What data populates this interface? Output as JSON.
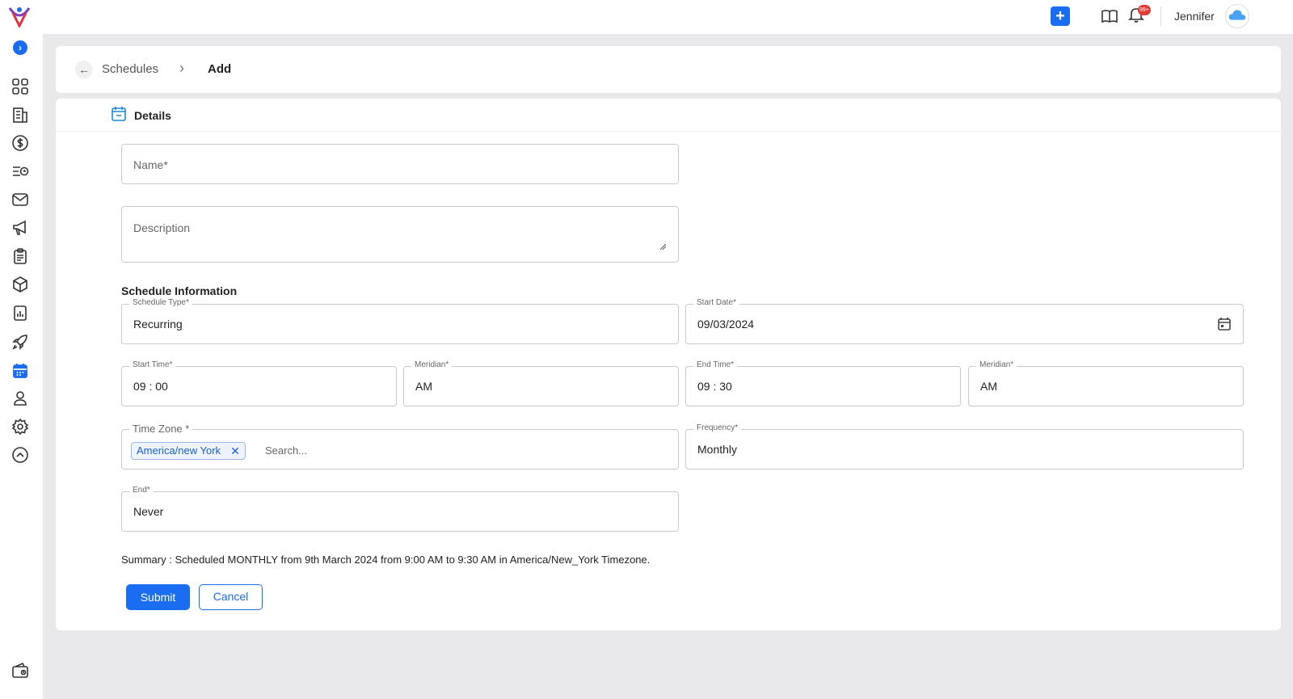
{
  "topbar": {
    "add_label": "+",
    "notification_badge": "99+",
    "username": "Jennifer"
  },
  "sidebar": {
    "toggle": "›",
    "items": [
      {
        "name": "dashboard-icon"
      },
      {
        "name": "building-icon"
      },
      {
        "name": "dollar-icon"
      },
      {
        "name": "list-clock-icon"
      },
      {
        "name": "mail-icon"
      },
      {
        "name": "megaphone-icon"
      },
      {
        "name": "clipboard-icon"
      },
      {
        "name": "cube-icon"
      },
      {
        "name": "report-icon"
      },
      {
        "name": "rocket-icon"
      },
      {
        "name": "calendar-icon",
        "active": true
      },
      {
        "name": "user-icon"
      },
      {
        "name": "settings-icon"
      },
      {
        "name": "chevron-up-icon"
      },
      {
        "name": "wallet-icon"
      }
    ]
  },
  "breadcrumb": {
    "back": "←",
    "parent": "Schedules",
    "separator": "›",
    "current": "Add"
  },
  "details": {
    "title": "Details"
  },
  "form": {
    "name_placeholder": "Name*",
    "description_placeholder": "Description",
    "section_title": "Schedule Information",
    "schedule_type": {
      "label": "Schedule Type*",
      "value": "Recurring"
    },
    "start_date": {
      "label": "Start Date*",
      "value": "09/03/2024"
    },
    "start_time": {
      "label": "Start Time*",
      "value": "09 : 00"
    },
    "start_meridian": {
      "label": "Meridian*",
      "value": "AM"
    },
    "end_time": {
      "label": "End Time*",
      "value": "09 : 30"
    },
    "end_meridian": {
      "label": "Meridian*",
      "value": "AM"
    },
    "time_zone": {
      "label": "Time Zone *",
      "chip": "America/new York",
      "chip_remove": "✕",
      "search_placeholder": "Search..."
    },
    "frequency": {
      "label": "Frequency*",
      "value": "Monthly"
    },
    "end": {
      "label": "End*",
      "value": "Never"
    },
    "summary": "Summary : Scheduled MONTHLY from 9th March 2024 from 9:00 AM to 9:30 AM in America/New_York Timezone.",
    "submit_label": "Submit",
    "cancel_label": "Cancel"
  },
  "colors": {
    "primary": "#1a6cf0",
    "badge": "#e53935",
    "background": "#e9e9ec"
  }
}
